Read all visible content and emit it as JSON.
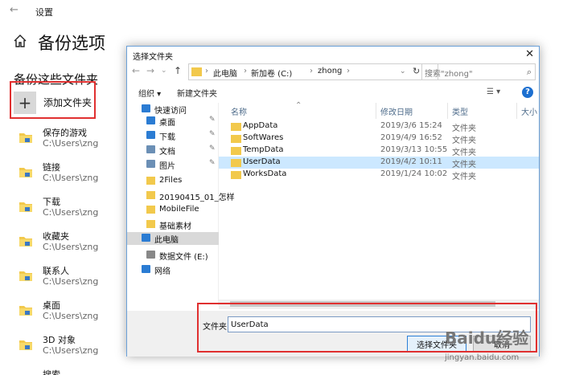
{
  "settings": {
    "window_title": "设置",
    "page_title": "备份选项",
    "section_title": "备份这些文件夹",
    "add_folder_label": "添加文件夹",
    "folders": [
      {
        "name": "保存的游戏",
        "path": "C:\\Users\\zng",
        "icon": "saved-games-icon"
      },
      {
        "name": "链接",
        "path": "C:\\Users\\zng",
        "icon": "links-icon"
      },
      {
        "name": "下载",
        "path": "C:\\Users\\zng",
        "icon": "downloads-icon"
      },
      {
        "name": "收藏夹",
        "path": "C:\\Users\\zng",
        "icon": "favorites-icon"
      },
      {
        "name": "联系人",
        "path": "C:\\Users\\zng",
        "icon": "contacts-icon"
      },
      {
        "name": "桌面",
        "path": "C:\\Users\\zng",
        "icon": "desktop-icon"
      },
      {
        "name": "3D 对象",
        "path": "C:\\Users\\zng",
        "icon": "3d-objects-icon"
      },
      {
        "name": "搜索",
        "path": "",
        "icon": "search-folder-icon"
      }
    ]
  },
  "dialog": {
    "title": "选择文件夹",
    "close_glyph": "✕",
    "breadcrumb": [
      "此电脑",
      "新加卷 (C:)",
      "zhong"
    ],
    "search_placeholder": "搜索\"zhong\"",
    "toolbar": {
      "organize": "组织 ▾",
      "new_folder": "新建文件夹",
      "help": "?"
    },
    "nav_items": [
      {
        "label": "快速访问",
        "icon": "star-icon",
        "color": "#2b7cd3",
        "pinned": false,
        "selected": false
      },
      {
        "label": "桌面",
        "icon": "desktop-icon",
        "color": "#2b7cd3",
        "pinned": true,
        "selected": false
      },
      {
        "label": "下载",
        "icon": "download-icon",
        "color": "#2b7cd3",
        "pinned": true,
        "selected": false
      },
      {
        "label": "文档",
        "icon": "document-icon",
        "color": "#6b8fb5",
        "pinned": true,
        "selected": false
      },
      {
        "label": "图片",
        "icon": "picture-icon",
        "color": "#6b8fb5",
        "pinned": true,
        "selected": false
      },
      {
        "label": "2Files",
        "icon": "folder-icon",
        "color": "#f2c94c",
        "pinned": false,
        "selected": false
      },
      {
        "label": "20190415_01_怎样",
        "icon": "folder-icon",
        "color": "#f2c94c",
        "pinned": false,
        "selected": false
      },
      {
        "label": "MobileFile",
        "icon": "folder-icon",
        "color": "#f2c94c",
        "pinned": false,
        "selected": false
      },
      {
        "label": "基础素材",
        "icon": "folder-icon",
        "color": "#f2c94c",
        "pinned": false,
        "selected": false
      },
      {
        "label": "此电脑",
        "icon": "computer-icon",
        "color": "#2b7cd3",
        "pinned": false,
        "selected": true
      },
      {
        "label": "数据文件 (E:)",
        "icon": "drive-icon",
        "color": "#888888",
        "pinned": false,
        "selected": false
      },
      {
        "label": "网络",
        "icon": "network-icon",
        "color": "#2b7cd3",
        "pinned": false,
        "selected": false
      }
    ],
    "columns": {
      "name": "名称",
      "date": "修改日期",
      "type": "类型",
      "size": "大小"
    },
    "files": [
      {
        "name": "AppData",
        "date": "2019/3/6 15:24",
        "type": "文件夹",
        "selected": false
      },
      {
        "name": "SoftWares",
        "date": "2019/4/9 16:52",
        "type": "文件夹",
        "selected": false
      },
      {
        "name": "TempData",
        "date": "2019/3/13 10:55",
        "type": "文件夹",
        "selected": false
      },
      {
        "name": "UserData",
        "date": "2019/4/2 10:11",
        "type": "文件夹",
        "selected": true
      },
      {
        "name": "WorksData",
        "date": "2019/1/24 10:02",
        "type": "文件夹",
        "selected": false
      }
    ],
    "folder_label": "文件夹:",
    "folder_value": "UserData",
    "ok_label": "选择文件夹",
    "cancel_label": "取消"
  },
  "watermark": {
    "text": "Baidu经验",
    "sub": "jingyan.baidu.com"
  },
  "colors": {
    "highlight": "#e03030",
    "accent": "#2b7cd3",
    "folder": "#f2c94c",
    "selection": "#cce8ff"
  }
}
